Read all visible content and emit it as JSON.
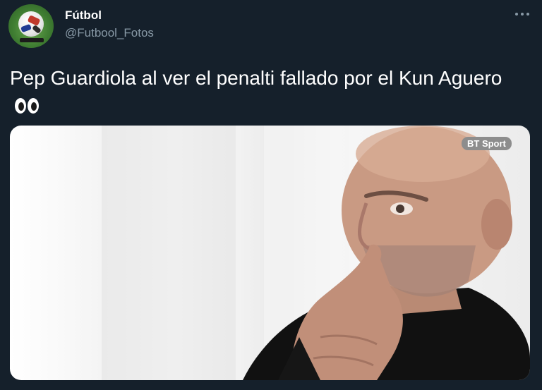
{
  "tweet": {
    "display_name": "Fútbol",
    "handle": "@Futbool_Fotos",
    "text": "Pep Guardiola al ver el penalti fallado por el Kun Aguero",
    "emoji_icon": "eyes-emoji-icon"
  },
  "media": {
    "watermark": "BT Sport"
  },
  "colors": {
    "background": "#15202b",
    "secondary_text": "#8899a6",
    "primary_text": "#ffffff"
  }
}
